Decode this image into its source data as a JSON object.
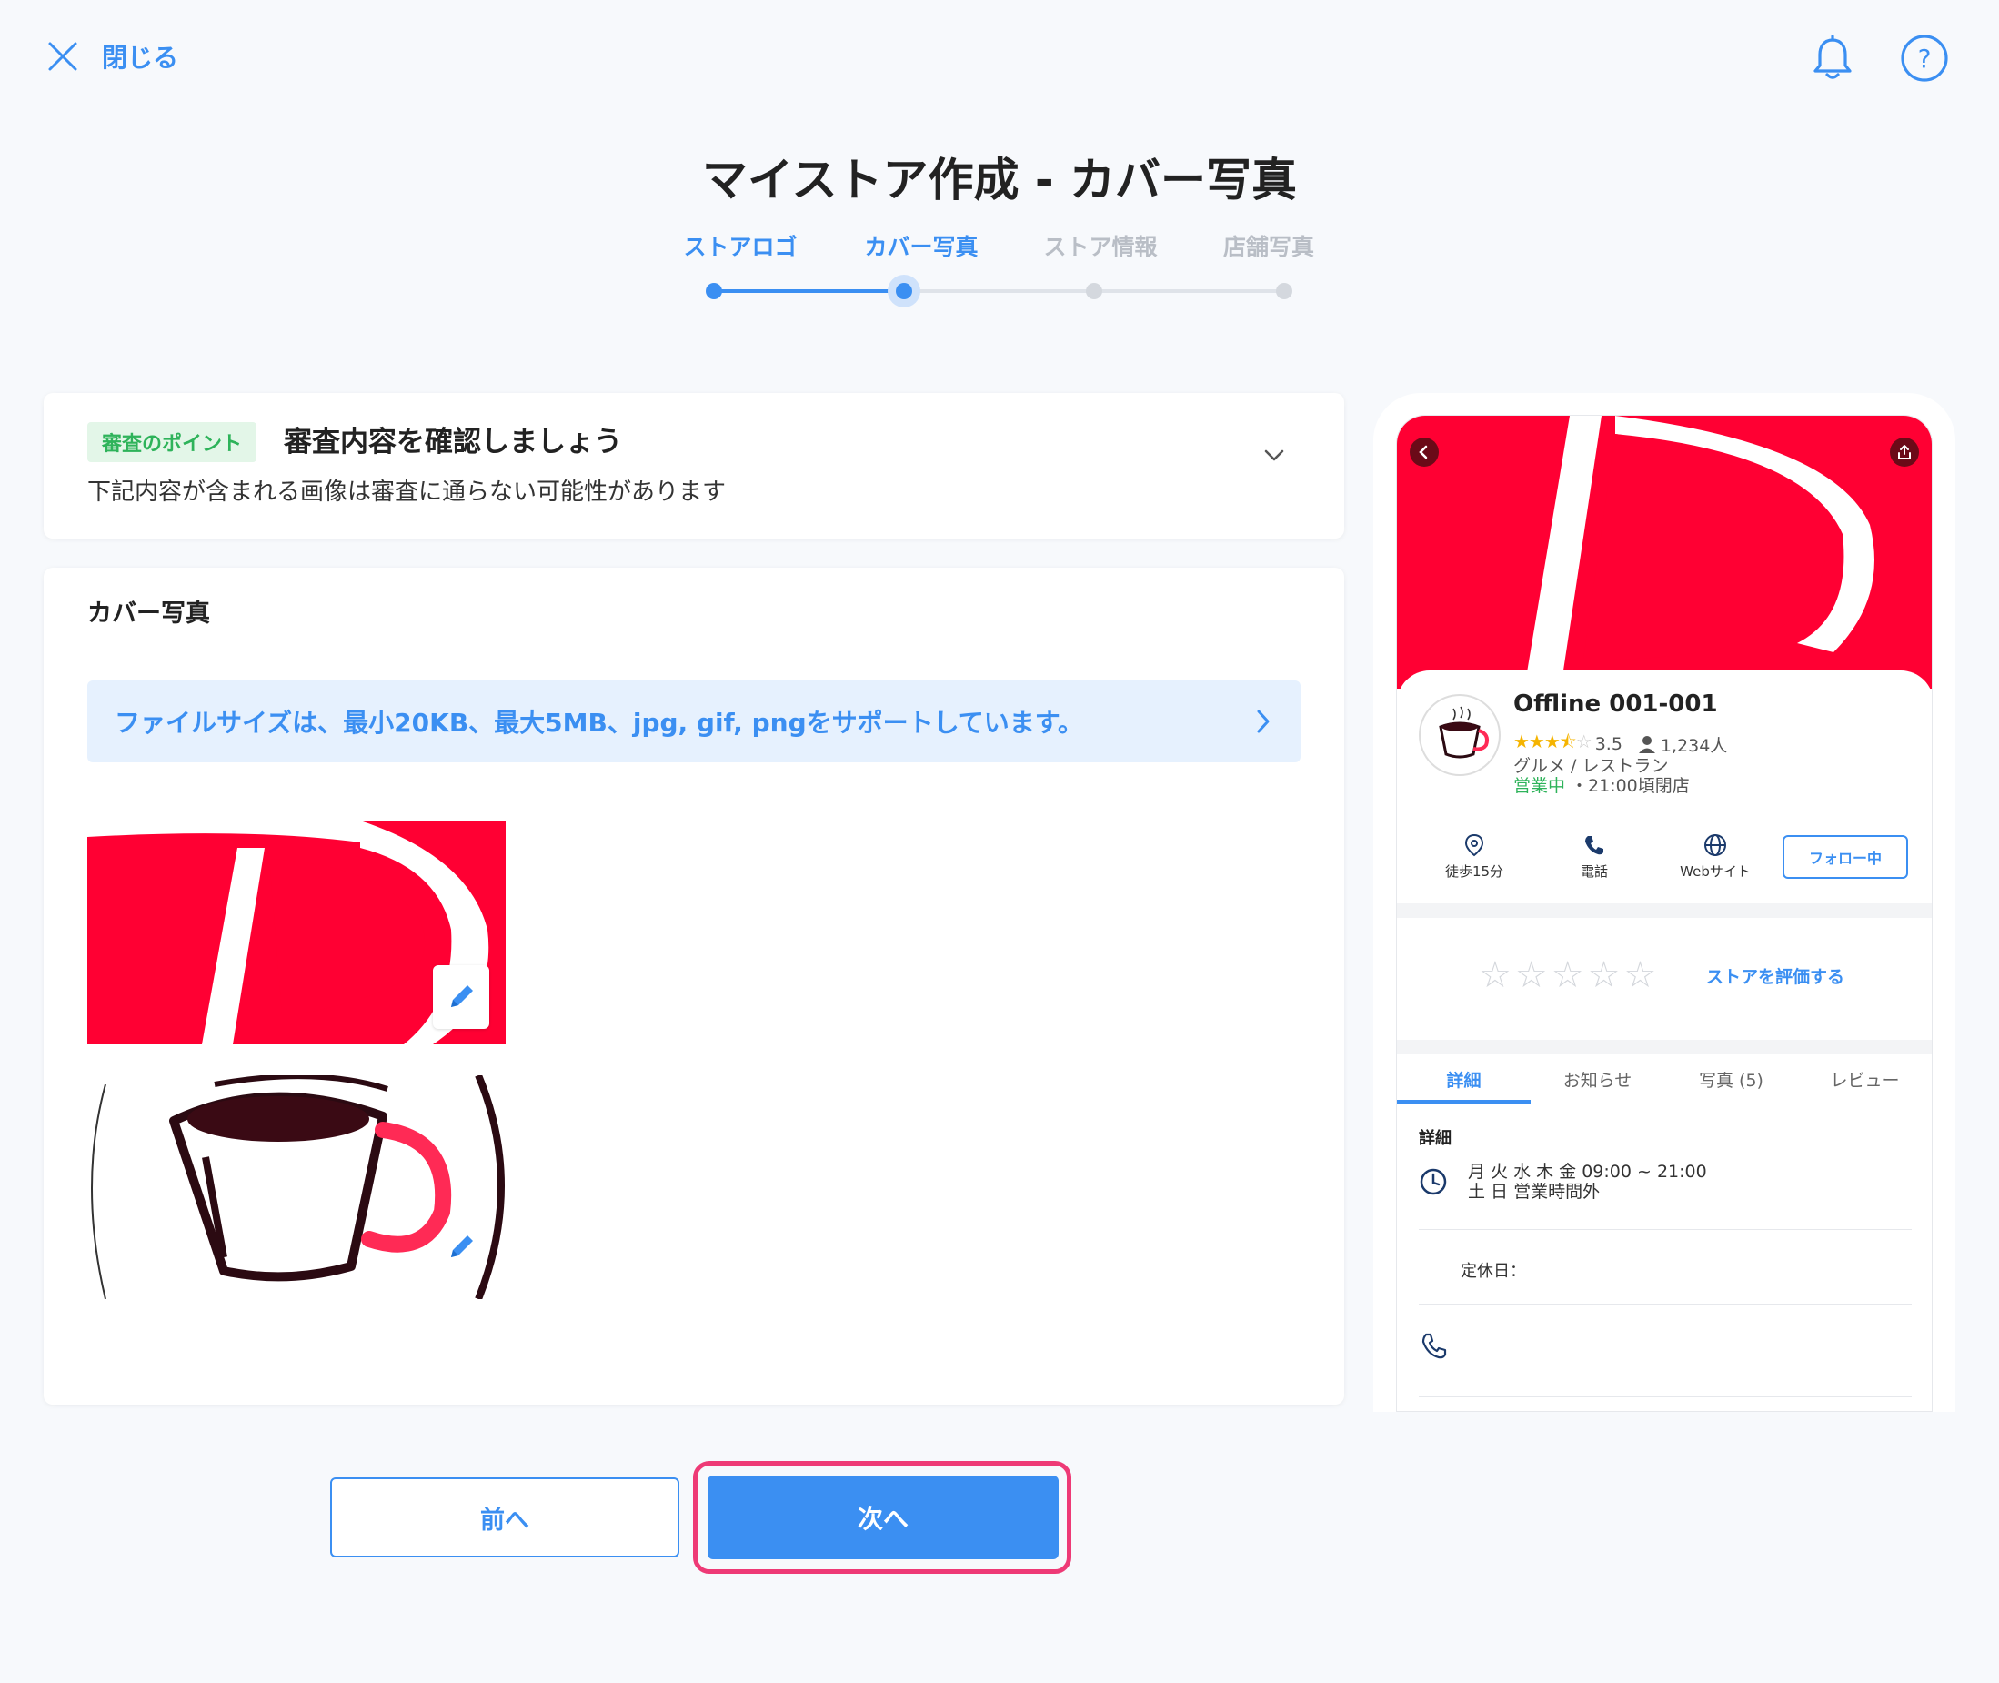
{
  "header": {
    "close_label": "閉じる",
    "bell_icon": "bell-icon",
    "help_icon": "help-icon",
    "accent_color": "#3b8ff2"
  },
  "page_title": "マイストア作成 - カバー写真",
  "stepper": {
    "steps": [
      {
        "label": "ストアロゴ",
        "state": "done"
      },
      {
        "label": "カバー写真",
        "state": "current"
      },
      {
        "label": "ストア情報",
        "state": "todo"
      },
      {
        "label": "店舗写真",
        "state": "todo"
      }
    ]
  },
  "review": {
    "badge": "審査のポイント",
    "title": "審査内容を確認しましょう",
    "subtitle": "下記内容が含まれる画像は審査に通らない可能性があります"
  },
  "cover": {
    "section_title": "カバー写真",
    "info_text": "ファイルサイズは、最小20KB、最大5MB、jpg, gif, pngをサポートしています。"
  },
  "buttons": {
    "prev": "前へ",
    "next": "次へ",
    "highlight_color": "#ee3a76"
  },
  "preview": {
    "store_name": "Offline 001-001",
    "rating": "3.5",
    "followers": "1,234人",
    "category": "グルメ / レストラン",
    "open_status": "営業中",
    "close_time": "・21:00頃閉店",
    "actions": {
      "walk": "徒歩15分",
      "phone": "電話",
      "web": "Webサイト",
      "follow": "フォロー中"
    },
    "rate_store": "ストアを評価する",
    "tabs": [
      "詳細",
      "お知らせ",
      "写真 (5)",
      "レビュー"
    ],
    "detail_title": "詳細",
    "hours_line1": "月 火 水 木 金 09:00 ~ 21:00",
    "hours_line2": "土 日 営業時間外",
    "holiday": "定休日：",
    "brand_red": "#ff0033"
  }
}
